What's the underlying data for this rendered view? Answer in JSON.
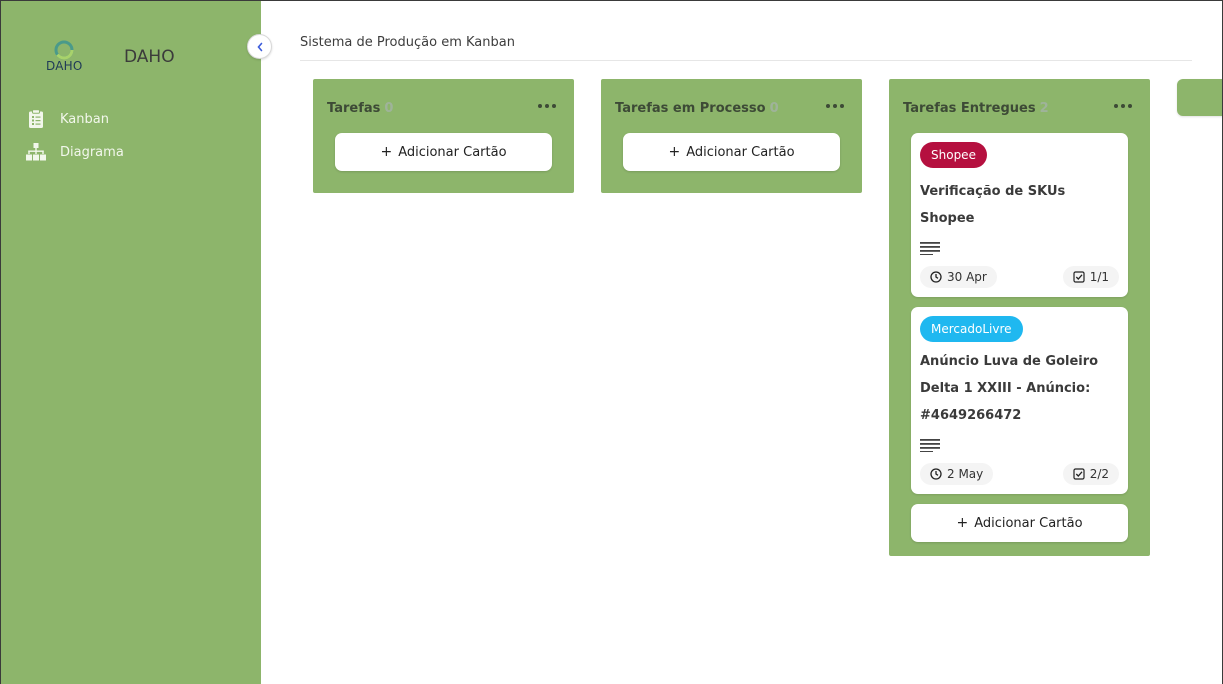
{
  "sidebar": {
    "logo_text": "DAHO",
    "brand": "DAHO",
    "collapse_icon": "chevron-left-icon",
    "items": [
      {
        "label": "Kanban",
        "icon": "clipboard-icon"
      },
      {
        "label": "Diagrama",
        "icon": "sitemap-icon"
      }
    ]
  },
  "header": {
    "title": "Sistema de Produção em Kanban"
  },
  "columns": [
    {
      "title": "Tarefas",
      "count": "0",
      "add_label": "Adicionar Cartão",
      "cards": []
    },
    {
      "title": "Tarefas em Processo",
      "count": "0",
      "add_label": "Adicionar Cartão",
      "cards": []
    },
    {
      "title": "Tarefas Entregues",
      "count": "2",
      "add_label": "Adicionar Cartão",
      "cards": [
        {
          "tag": "Shopee",
          "tag_color": "#b5103f",
          "title": "Verificação de SKUs Shopee",
          "date": "30 Apr",
          "checklist": "1/1"
        },
        {
          "tag": "MercadoLivre",
          "tag_color": "#1fb8f0",
          "title": "Anúncio Luva de Goleiro Delta 1 XXIII - Anúncio: #4649266472",
          "date": "2 May",
          "checklist": "2/2"
        }
      ]
    }
  ],
  "colors": {
    "sidebar": "#8db56b",
    "column": "#8db56b"
  }
}
